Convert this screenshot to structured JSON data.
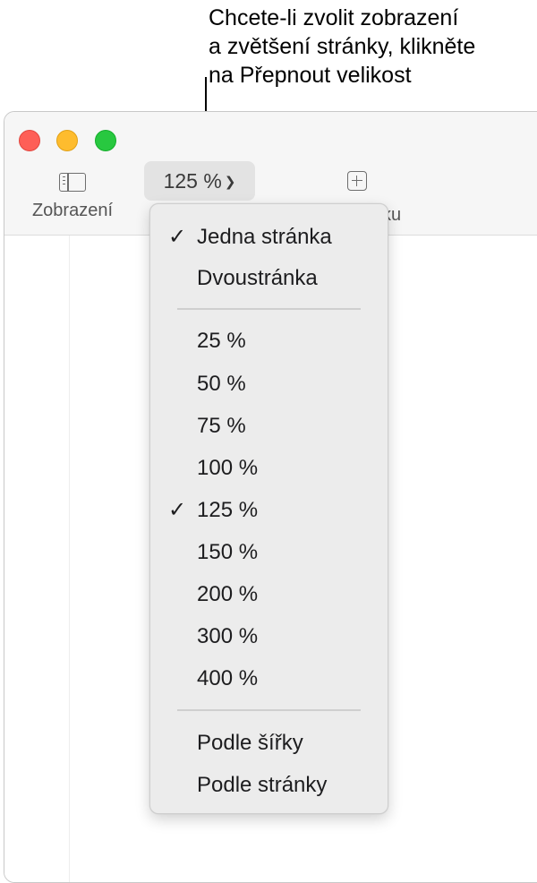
{
  "callout": {
    "lines": [
      "Chcete-li zvolit zobrazení",
      "a zvětšení stránky, klikněte",
      "na Přepnout velikost"
    ]
  },
  "toolbar": {
    "view_label": "Zobrazení",
    "zoom_value": "125 %",
    "insert_label_partial": "ku"
  },
  "menu": {
    "layout_items": [
      {
        "label": "Jedna stránka",
        "checked": true
      },
      {
        "label": "Dvoustránka",
        "checked": false
      }
    ],
    "zoom_items": [
      {
        "label": "25 %",
        "checked": false
      },
      {
        "label": "50 %",
        "checked": false
      },
      {
        "label": "75 %",
        "checked": false
      },
      {
        "label": "100 %",
        "checked": false
      },
      {
        "label": "125 %",
        "checked": true
      },
      {
        "label": "150 %",
        "checked": false
      },
      {
        "label": "200 %",
        "checked": false
      },
      {
        "label": "300 %",
        "checked": false
      },
      {
        "label": "400 %",
        "checked": false
      }
    ],
    "fit_items": [
      {
        "label": "Podle šířky",
        "checked": false
      },
      {
        "label": "Podle stránky",
        "checked": false
      }
    ],
    "check_glyph": "✓"
  },
  "colors": {
    "close": "#fe5f57",
    "minimize": "#febc2e",
    "zoom": "#28c840",
    "menu_background": "#ececec"
  },
  "icons": {
    "view": "sidebar-icon",
    "zoom_chevron": "chevron-down-icon",
    "insert": "plus-square-icon",
    "check": "checkmark-icon"
  }
}
